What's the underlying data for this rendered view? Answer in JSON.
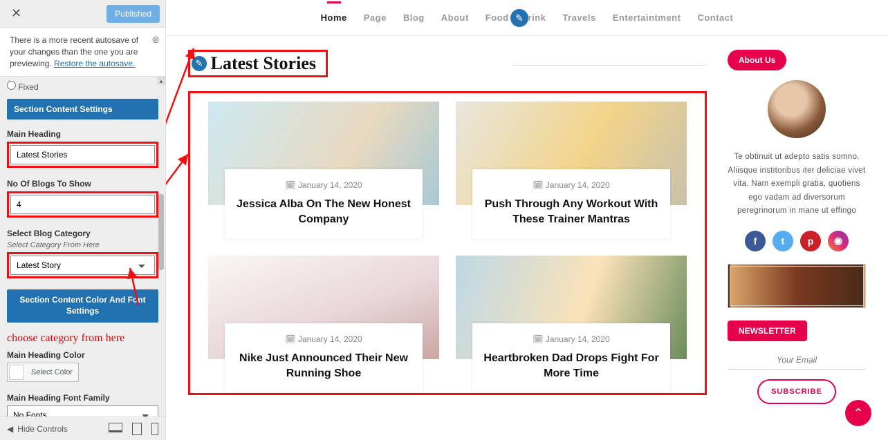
{
  "sidebar": {
    "published_label": "Published",
    "notice_text": "There is a more recent autosave of your changes than the one you are previewing. ",
    "notice_link": "Restore the autosave.",
    "fixed_label": "Fixed",
    "acc_content": "Section Content Settings",
    "main_heading_label": "Main Heading",
    "main_heading_value": "Latest Stories",
    "no_blogs_label": "No Of Blogs To Show",
    "no_blogs_value": "4",
    "select_cat_label": "Select Blog Category",
    "select_cat_hint": "Select Category From Here",
    "select_cat_value": "Latest Story",
    "acc_colorfont": "Section Content Color And Font Settings",
    "annotation": "choose category from here",
    "heading_color_label": "Main Heading Color",
    "select_color_label": "Select Color",
    "font_family_label": "Main Heading Font Family",
    "font_family_value": "No Fonts",
    "hide_controls": "Hide Controls"
  },
  "nav": {
    "items": [
      {
        "label": "Home",
        "active": true
      },
      {
        "label": "Page"
      },
      {
        "label": "Blog"
      },
      {
        "label": "About"
      },
      {
        "label": "Food & Drink"
      },
      {
        "label": "Travels"
      },
      {
        "label": "Entertaintment"
      },
      {
        "label": "Contact"
      }
    ]
  },
  "section": {
    "heading": "Latest Stories"
  },
  "stories": [
    {
      "date": "January 14, 2020",
      "title": "Jessica Alba On The New Honest Company"
    },
    {
      "date": "January 14, 2020",
      "title": "Push Through Any Workout With These Trainer Mantras"
    },
    {
      "date": "January 14, 2020",
      "title": "Nike Just Announced Their New Running Shoe"
    },
    {
      "date": "January 14, 2020",
      "title": "Heartbroken Dad Drops Fight For More Time"
    }
  ],
  "aside": {
    "about_pill": "About Us",
    "about_text": "Te obtinuit ut adepto satis somno. Aliisque institoribus iter deliciae vivet vita. Nam exempli gratia, quotiens ego vadam ad diversorum peregrinorum in mane ut effingo",
    "newsletter_pill": "NEWSLETTER",
    "newsletter_placeholder": "Your Email",
    "subscribe_label": "SUBSCRIBE"
  },
  "colors": {
    "accent": "#e6004c",
    "wp_blue": "#2271b1",
    "annotation_red": "#e11"
  }
}
